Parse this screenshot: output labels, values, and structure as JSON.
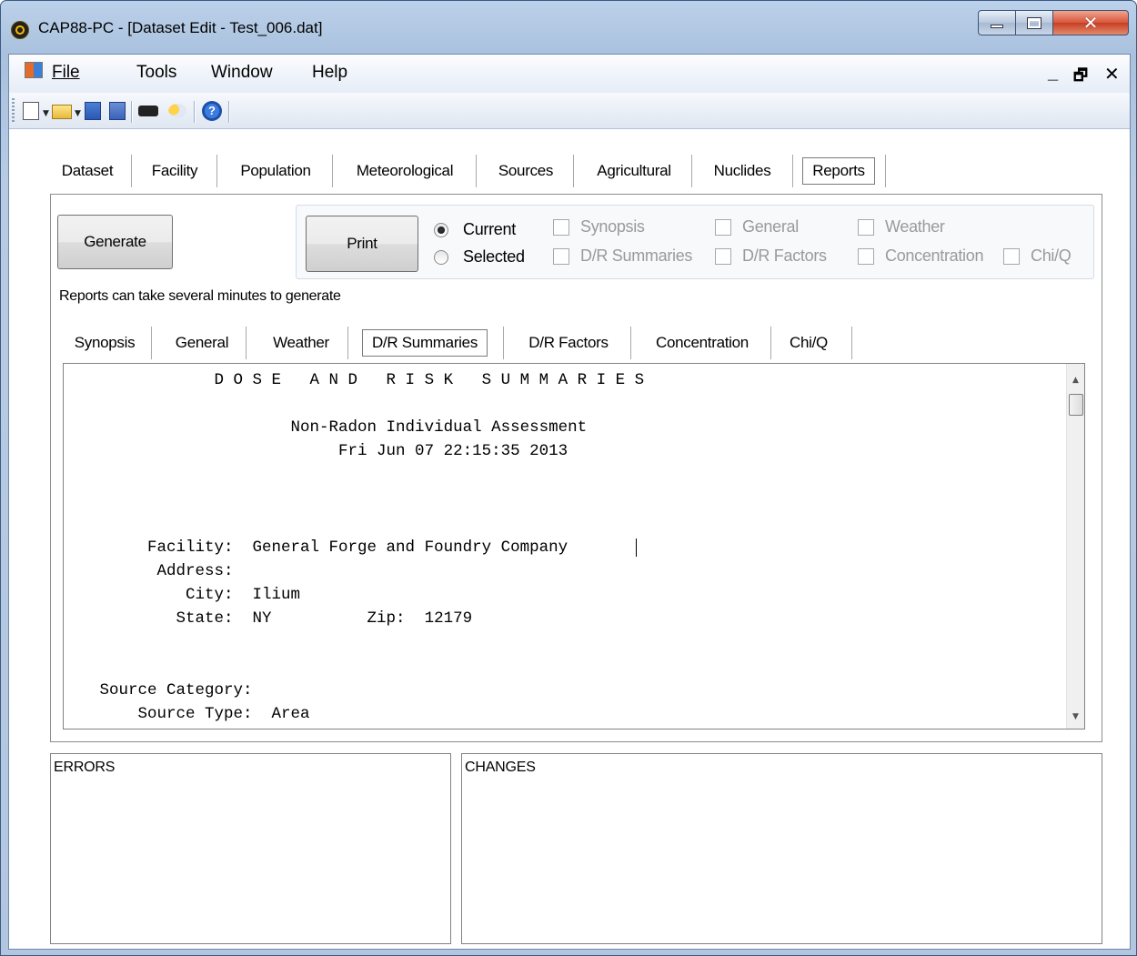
{
  "window": {
    "title": "CAP88-PC - [Dataset Edit - Test_006.dat]"
  },
  "menu": {
    "file": "File",
    "tools": "Tools",
    "window": "Window",
    "help": "Help"
  },
  "mdi_controls": {
    "minimize": "_",
    "restore": "🗗",
    "close": "✕"
  },
  "tabs": [
    "Dataset",
    "Facility",
    "Population",
    "Meteorological",
    "Sources",
    "Agricultural",
    "Nuclides",
    "Reports"
  ],
  "active_tab": "Reports",
  "reports": {
    "generate_label": "Generate",
    "print_label": "Print",
    "radio_current": "Current",
    "radio_selected": "Selected",
    "checkboxes": [
      "Synopsis",
      "General",
      "Weather",
      "D/R Summaries",
      "D/R Factors",
      "Concentration",
      "Chi/Q"
    ],
    "hint": "Reports can take several minutes to generate"
  },
  "report_tabs": [
    "Synopsis",
    "General",
    "Weather",
    "D/R Summaries",
    "D/R Factors",
    "Concentration",
    "Chi/Q"
  ],
  "active_report_tab": "D/R Summaries",
  "report_lines": [
    "               D O S E   A N D   R I S K   S U M M A R I E S",
    "",
    "                       Non-Radon Individual Assessment",
    "                            Fri Jun 07 22:15:35 2013",
    "",
    "",
    "",
    "        Facility:  General Forge and Foundry Company",
    "         Address:",
    "            City:  Ilium",
    "           State:  NY          Zip:  12179",
    "",
    "",
    "",
    "   Source Category:",
    "       Source Type:  Area"
  ],
  "errors_label": "ERRORS",
  "changes_label": "CHANGES"
}
